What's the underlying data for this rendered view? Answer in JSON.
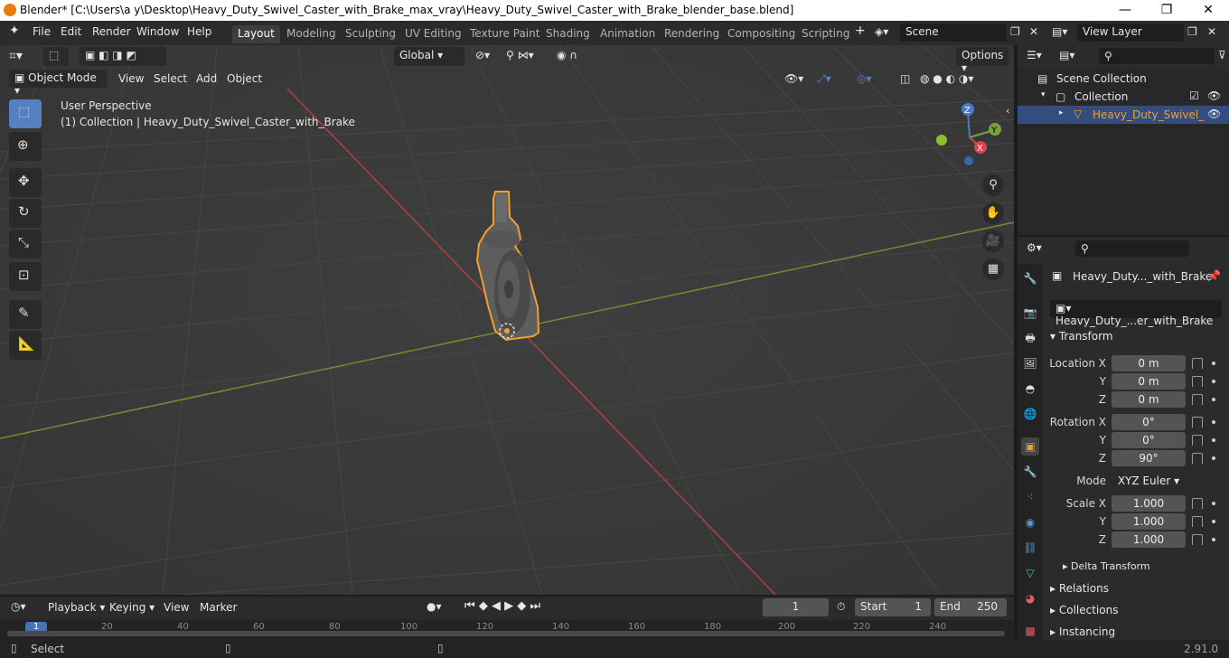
{
  "titlebar": {
    "title": "Blender* [C:\\Users\\a y\\Desktop\\Heavy_Duty_Swivel_Caster_with_Brake_max_vray\\Heavy_Duty_Swivel_Caster_with_Brake_blender_base.blend]",
    "minimize": "—",
    "maximize": "❐",
    "close": "✕"
  },
  "menus": [
    "File",
    "Edit",
    "Render",
    "Window",
    "Help"
  ],
  "workspaces": [
    "Layout",
    "Modeling",
    "Sculpting",
    "UV Editing",
    "Texture Paint",
    "Shading",
    "Animation",
    "Rendering",
    "Compositing",
    "Scripting"
  ],
  "scene": {
    "label": "Scene",
    "view_layer": "View Layer"
  },
  "header": {
    "mode": "Object Mode",
    "view": "View",
    "select": "Select",
    "add": "Add",
    "object": "Object",
    "orientation": "Global",
    "options": "Options"
  },
  "viewport": {
    "perspective": "User Perspective",
    "collection_info": "(1) Collection | Heavy_Duty_Swivel_Caster_with_Brake",
    "gizmo": {
      "x": "X",
      "y": "Y",
      "z": "Z"
    }
  },
  "outliner": {
    "scene_collection": "Scene Collection",
    "collection": "Collection",
    "object": "Heavy_Duty_Swivel_"
  },
  "properties": {
    "object_name": "Heavy_Duty..._with_Brake",
    "data_name": "Heavy_Duty_...er_with_Brake",
    "transform": "Transform",
    "location_label": "Location X",
    "rotation_label": "Rotation X",
    "scale_label": "Scale X",
    "y_label": "Y",
    "z_label": "Z",
    "location": [
      "0 m",
      "0 m",
      "0 m"
    ],
    "rotation": [
      "0°",
      "0°",
      "90°"
    ],
    "mode_label": "Mode",
    "mode_value": "XYZ Euler",
    "scale": [
      "1.000",
      "1.000",
      "1.000"
    ],
    "delta_transform": "Delta Transform",
    "relations": "Relations",
    "collections": "Collections",
    "instancing": "Instancing"
  },
  "timeline": {
    "playback": "Playback",
    "keying": "Keying",
    "view": "View",
    "marker": "Marker",
    "current_frame": "1",
    "start_label": "Start",
    "start_value": "1",
    "end_label": "End",
    "end_value": "250",
    "ruler": [
      "1",
      "20",
      "40",
      "60",
      "80",
      "100",
      "120",
      "140",
      "160",
      "180",
      "200",
      "220",
      "240"
    ]
  },
  "status": {
    "select": "Select",
    "version": "2.91.0"
  },
  "colors": {
    "accent": "#5680c2",
    "selection": "#f0a030",
    "x_axis": "#c84a4a",
    "y_axis": "#7aa03c",
    "active_tab": "#3d3d3d"
  }
}
